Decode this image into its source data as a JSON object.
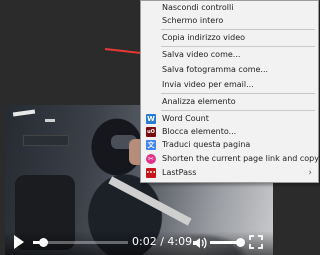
{
  "menu": {
    "items": [
      {
        "label": "Nascondi controlli"
      },
      {
        "label": "Schermo intero"
      },
      {
        "label": "Copia indirizzo video"
      },
      {
        "label": "Salva video come..."
      },
      {
        "label": "Salva fotogramma come..."
      },
      {
        "label": "Invia video per email..."
      },
      {
        "label": "Analizza elemento"
      },
      {
        "label": "Word Count",
        "icon": "word-count-icon",
        "icon_text": "W",
        "icon_color": "#2b7cd3"
      },
      {
        "label": "Blocca elemento...",
        "icon": "ublock-icon",
        "icon_text": "uO",
        "icon_color": "#7a0e0e"
      },
      {
        "label": "Traduci questa pagina",
        "icon": "translate-icon",
        "icon_text": "文",
        "icon_color": "#4285f4"
      },
      {
        "label": "Shorten the current page link and copy",
        "icon": "link-shortener-icon",
        "icon_text": "✂",
        "icon_color": "#e0338a"
      },
      {
        "label": "LastPass",
        "icon": "lastpass-icon",
        "icon_text": "•••",
        "icon_color": "#c4161c"
      }
    ]
  },
  "player": {
    "time": "0:02 / 4:09",
    "progress_fraction": 0.11,
    "volume_fraction": 0.9
  },
  "colors": {
    "menu_bg": "#f2f2f2",
    "annotation_arrow": "#e53935"
  }
}
